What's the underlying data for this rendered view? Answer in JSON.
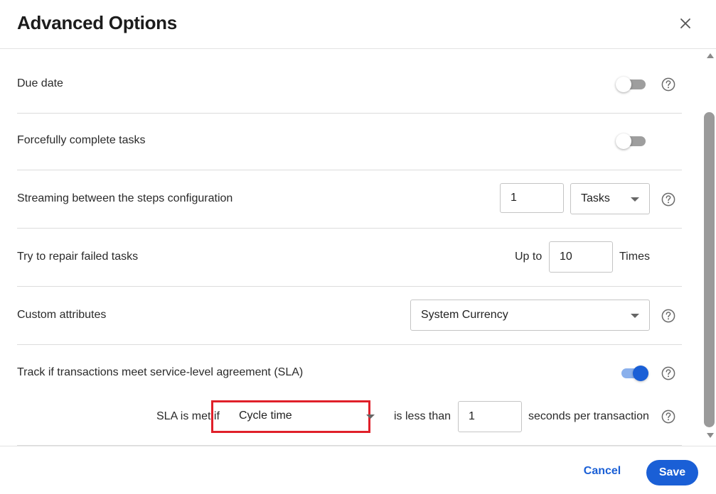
{
  "dialog": {
    "title": "Advanced Options",
    "close_icon": "close-icon"
  },
  "rows": {
    "due_date": {
      "label": "Due date",
      "enabled": false
    },
    "force_complete": {
      "label": "Forcefully complete tasks",
      "enabled": false
    },
    "streaming": {
      "label": "Streaming between the steps configuration",
      "value": "1",
      "unit": "Tasks"
    },
    "repair": {
      "label": "Try to repair failed tasks",
      "prefix": "Up to",
      "value": "10",
      "suffix": "Times"
    },
    "custom_attributes": {
      "label": "Custom attributes",
      "value": "System Currency"
    },
    "sla": {
      "label": "Track if transactions meet service-level agreement (SLA)",
      "enabled": true,
      "condition_prefix": "SLA is met if",
      "metric": "Cycle time",
      "comparator": "is less than",
      "threshold": "1",
      "unit": "seconds per transaction"
    }
  },
  "footer": {
    "cancel_label": "Cancel",
    "save_label": "Save"
  },
  "colors": {
    "accent": "#1a5fd6",
    "highlight": "#e0202a",
    "toggle_off": "#9e9e9e"
  }
}
